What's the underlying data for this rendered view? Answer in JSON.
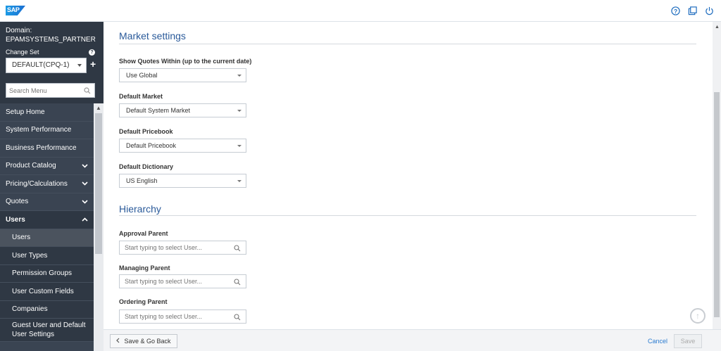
{
  "header": {
    "logo_text": "SAP",
    "icons": [
      "help-icon",
      "external-window-icon",
      "power-icon"
    ]
  },
  "sidebar": {
    "domain_label": "Domain:",
    "domain_value": "EPAMSYSTEMS_PARTNER",
    "changeset_label": "Change Set",
    "changeset_value": "DEFAULT(CPQ-1)",
    "search_placeholder": "Search Menu",
    "items": [
      {
        "label": "Setup Home"
      },
      {
        "label": "System Performance"
      },
      {
        "label": "Business Performance"
      },
      {
        "label": "Product Catalog"
      },
      {
        "label": "Pricing/Calculations"
      },
      {
        "label": "Quotes"
      },
      {
        "label": "Users"
      }
    ],
    "sub_items": [
      {
        "label": "Users"
      },
      {
        "label": "User Types"
      },
      {
        "label": "Permission Groups"
      },
      {
        "label": "User Custom Fields"
      },
      {
        "label": "Companies"
      },
      {
        "label": "Guest User and Default User Settings"
      }
    ]
  },
  "main": {
    "market_title": "Market settings",
    "show_quotes_label": "Show Quotes Within (up to the current date)",
    "show_quotes_value": "Use Global",
    "default_market_label": "Default Market",
    "default_market_value": "Default System Market",
    "default_pricebook_label": "Default Pricebook",
    "default_pricebook_value": "Default Pricebook",
    "default_dictionary_label": "Default Dictionary",
    "default_dictionary_value": "US English",
    "hierarchy_title": "Hierarchy",
    "approval_parent_label": "Approval Parent",
    "managing_parent_label": "Managing Parent",
    "ordering_parent_label": "Ordering Parent",
    "user_placeholder": "Start typing to select User..."
  },
  "footer": {
    "save_go_back": "Save & Go Back",
    "cancel": "Cancel",
    "save": "Save"
  }
}
